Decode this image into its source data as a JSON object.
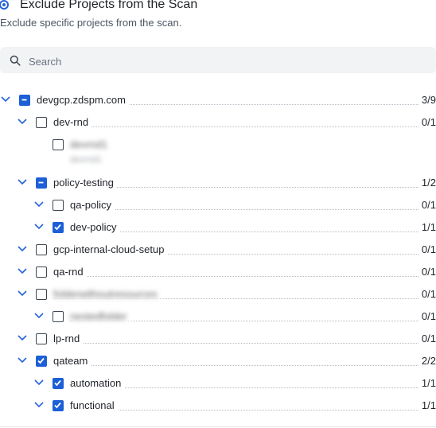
{
  "header": {
    "title": "Exclude Projects from the Scan",
    "subtitle": "Exclude specific projects from the scan."
  },
  "search": {
    "placeholder": "Search",
    "value": ""
  },
  "tree": [
    {
      "label": "devgcp.zdspm.com",
      "count": "3/9",
      "state": "partial",
      "expanded": true,
      "blurred": false
    },
    {
      "label": "dev-rnd",
      "count": "0/1",
      "state": "unchecked",
      "expanded": true,
      "blurred": false
    },
    {
      "label": "devrnd1",
      "sublabel": "devrnd1",
      "count": "",
      "state": "unchecked",
      "expanded": false,
      "blurred": true
    },
    {
      "label": "policy-testing",
      "count": "1/2",
      "state": "partial",
      "expanded": true,
      "blurred": false
    },
    {
      "label": "qa-policy",
      "count": "0/1",
      "state": "unchecked",
      "expanded": true,
      "blurred": false
    },
    {
      "label": "dev-policy",
      "count": "1/1",
      "state": "checked",
      "expanded": true,
      "blurred": false
    },
    {
      "label": "gcp-internal-cloud-setup",
      "count": "0/1",
      "state": "unchecked",
      "expanded": true,
      "blurred": false
    },
    {
      "label": "qa-rnd",
      "count": "0/1",
      "state": "unchecked",
      "expanded": true,
      "blurred": false
    },
    {
      "label": "folderwithoutresources",
      "count": "0/1",
      "state": "unchecked",
      "expanded": true,
      "blurred": true
    },
    {
      "label": "nestedfolder",
      "count": "0/1",
      "state": "unchecked",
      "expanded": true,
      "blurred": true
    },
    {
      "label": "lp-rnd",
      "count": "0/1",
      "state": "unchecked",
      "expanded": true,
      "blurred": false
    },
    {
      "label": "qateam",
      "count": "2/2",
      "state": "checked",
      "expanded": true,
      "blurred": false
    },
    {
      "label": "automation",
      "count": "1/1",
      "state": "checked",
      "expanded": true,
      "blurred": false
    },
    {
      "label": "functional",
      "count": "1/1",
      "state": "checked",
      "expanded": true,
      "blurred": false
    }
  ],
  "colors": {
    "accent": "#1d5fd6",
    "chevron": "#2563d9"
  },
  "icons": {
    "search": "search-icon",
    "chevron": "chevron-down-icon",
    "radio": "radio-selected-icon"
  }
}
